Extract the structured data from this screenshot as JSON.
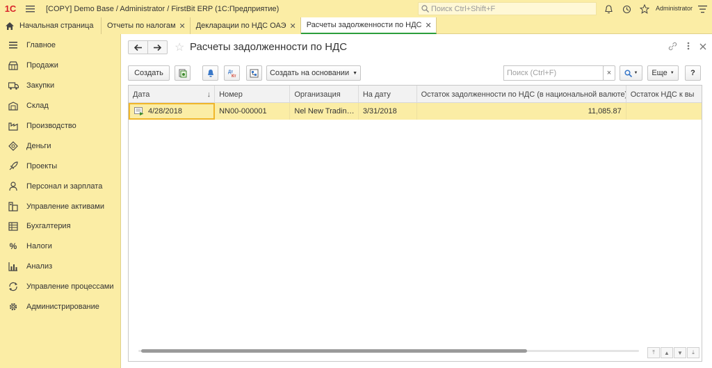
{
  "titlebar": {
    "logo": "1С",
    "app_title": "[COPY] Demo Base / Administrator / FirstBit ERP  (1С:Предприятие)",
    "search_placeholder": "Поиск Ctrl+Shift+F",
    "user": "Administrator"
  },
  "tabs": [
    {
      "label": "Начальная страница",
      "closable": false
    },
    {
      "label": "Отчеты по налогам",
      "closable": true
    },
    {
      "label": "Декларации по НДС ОАЭ",
      "closable": true
    },
    {
      "label": "Расчеты задолженности по НДС",
      "closable": true,
      "active": true
    }
  ],
  "sidebar": {
    "items": [
      {
        "label": "Главное",
        "icon": "menu-lines-icon"
      },
      {
        "label": "Продажи",
        "icon": "shop-icon"
      },
      {
        "label": "Закупки",
        "icon": "truck-icon"
      },
      {
        "label": "Склад",
        "icon": "warehouse-icon"
      },
      {
        "label": "Производство",
        "icon": "factory-icon"
      },
      {
        "label": "Деньги",
        "icon": "money-icon"
      },
      {
        "label": "Проекты",
        "icon": "rocket-icon"
      },
      {
        "label": "Персонал и зарплата",
        "icon": "person-icon"
      },
      {
        "label": "Управление активами",
        "icon": "assets-icon"
      },
      {
        "label": "Бухгалтерия",
        "icon": "ledger-icon"
      },
      {
        "label": "Налоги",
        "icon": "percent-icon"
      },
      {
        "label": "Анализ",
        "icon": "chart-icon"
      },
      {
        "label": "Управление процессами",
        "icon": "process-icon"
      },
      {
        "label": "Администрирование",
        "icon": "gear-icon"
      }
    ]
  },
  "page": {
    "title": "Расчеты задолженности по НДС"
  },
  "toolbar": {
    "create_label": "Создать",
    "create_based_label": "Создать на основании",
    "search_placeholder": "Поиск (Ctrl+F)",
    "clear_label": "×",
    "more_label": "Еще",
    "help_label": "?"
  },
  "grid": {
    "columns": [
      "Дата",
      "Номер",
      "Организация",
      "На дату",
      "Остаток задолженности по НДС (в национальной валюте)",
      "Остаток НДС к вы"
    ],
    "sort_indicator": "↓",
    "rows": [
      {
        "date": "4/28/2018",
        "number": "NN00-000001",
        "organization": "Nel New Tradin…",
        "on_date": "3/31/2018",
        "balance": "11,085.87",
        "vat_balance": ""
      }
    ]
  }
}
